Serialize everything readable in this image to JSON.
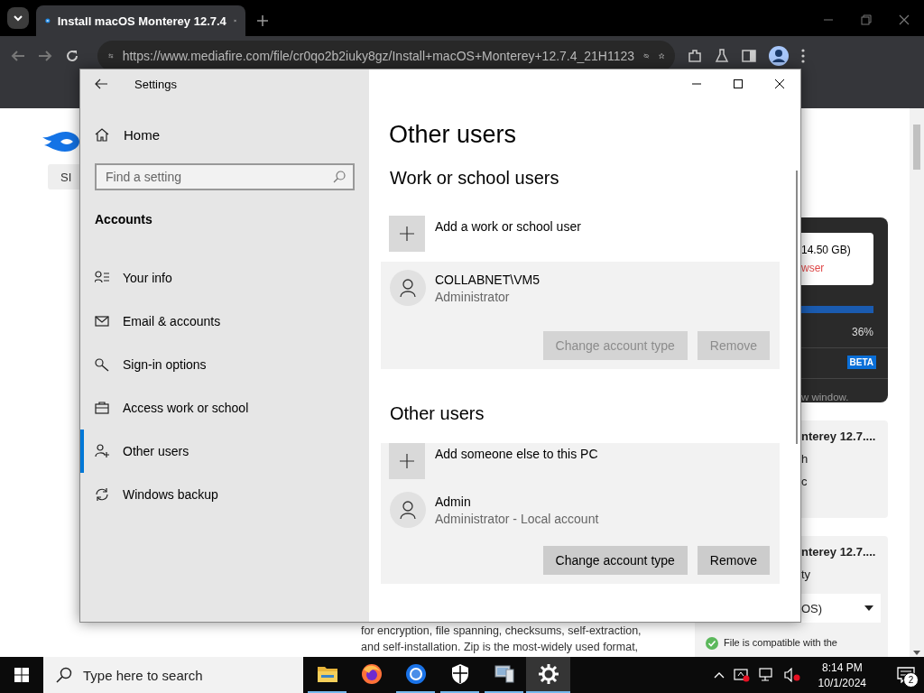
{
  "browser": {
    "tab": {
      "title": "Install macOS Monterey 12.7.4"
    },
    "url": "https://www.mediafire.com/file/cr0qo2b2iuky8gz/Install+macOS+Monterey+12.7.4_21H1123"
  },
  "page": {
    "sign_in": "SI",
    "download": {
      "size": "14.50 GB)",
      "warning": "wser",
      "percent": "36%",
      "badge": "BETA",
      "note": "w window."
    },
    "file_cards": [
      {
        "title": "nterey 12.7....",
        "lines": [
          "h",
          "c"
        ]
      },
      {
        "title": "nterey 12.7....",
        "lines": [
          "ty"
        ],
        "select": "OS)"
      }
    ],
    "description": [
      "for encryption, file spanning, checksums, self-extraction,",
      "and self-installation. Zip is the most-widely used format,"
    ],
    "compat": "File is compatible with the"
  },
  "settings": {
    "title": "Settings",
    "home": "Home",
    "search": {
      "placeholder": "Find a setting"
    },
    "section": "Accounts",
    "nav": [
      {
        "label": "Your info",
        "kind": "info",
        "selected": false
      },
      {
        "label": "Email & accounts",
        "kind": "email",
        "selected": false
      },
      {
        "label": "Sign-in options",
        "kind": "signin",
        "selected": false
      },
      {
        "label": "Access work or school",
        "kind": "work",
        "selected": false
      },
      {
        "label": "Other users",
        "kind": "users",
        "selected": true
      },
      {
        "label": "Windows backup",
        "kind": "backup",
        "selected": false
      }
    ],
    "heading": "Other users",
    "groups": [
      {
        "title": "Work or school users",
        "add": {
          "label": "Add a work or school user",
          "highlighted": false
        },
        "accounts": [
          {
            "name": "COLLABNET\\VM5",
            "role": "Administrator",
            "expanded": true,
            "actions": [
              {
                "label": "Change account type",
                "disabled": true
              },
              {
                "label": "Remove",
                "disabled": true
              }
            ]
          }
        ]
      },
      {
        "title": "Other users",
        "add": {
          "label": "Add someone else to this PC",
          "highlighted": true
        },
        "accounts": [
          {
            "name": "Admin",
            "role": "Administrator - Local account",
            "expanded": true,
            "actions": [
              {
                "label": "Change account type",
                "disabled": false
              },
              {
                "label": "Remove",
                "disabled": false
              }
            ]
          }
        ]
      }
    ]
  },
  "taskbar": {
    "search": {
      "placeholder": "Type here to search"
    },
    "apps": [
      {
        "kind": "folder",
        "running": true,
        "active": false
      },
      {
        "kind": "firefox",
        "running": false,
        "active": false
      },
      {
        "kind": "chrome",
        "running": true,
        "active": false
      },
      {
        "kind": "shield",
        "running": true,
        "active": false
      },
      {
        "kind": "computer",
        "running": true,
        "active": false
      },
      {
        "kind": "gear",
        "running": true,
        "active": true
      }
    ],
    "time": "8:14 PM",
    "date": "10/1/2024",
    "notifications": "2"
  }
}
